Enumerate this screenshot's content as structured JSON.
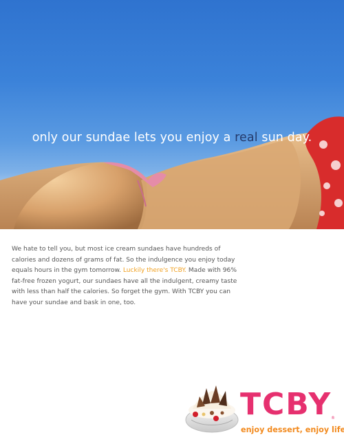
{
  "headline": {
    "before": "only our sundae lets you enjoy a ",
    "accent": "real",
    "after": " sun day."
  },
  "body": {
    "p1": "We hate to tell you, but most ice cream sundaes have hundreds of calories and dozens of grams of fat. So the indulgence you enjoy today equals hours in the gym tomorrow. ",
    "highlight": "Luckily there's TCBY.",
    "p2": " Made with 96% fat-free frozen yogurt, our sundaes have all the indulgent, creamy taste with less than half the calories. So forget the gym. With TCBY you can have your sundae and bask in one, too."
  },
  "brand": {
    "logo": "TCBY",
    "registered": "®",
    "tagline": "enjoy dessert, enjoy life."
  },
  "colors": {
    "brand_pink": "#e6306f",
    "tagline_orange": "#f28a1e",
    "highlight_orange": "#f0a020",
    "headline_accent": "#243a6b",
    "sky_blue": "#3b82d9"
  }
}
